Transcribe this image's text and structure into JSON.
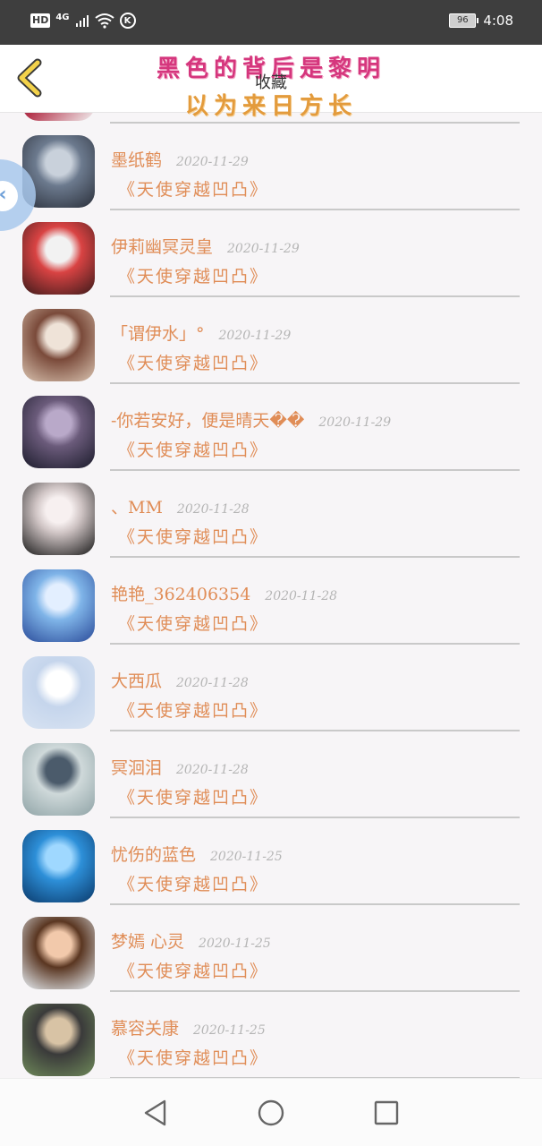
{
  "status_bar": {
    "hd": "HD",
    "network": "4G",
    "battery": "96",
    "time": "4:08",
    "icons": [
      "hd-icon",
      "signal-icon",
      "wifi-icon",
      "k-icon",
      "battery-icon"
    ]
  },
  "header": {
    "overlay_line1": "黑色的背后是黎明",
    "overlay_line2": "以为来日方长",
    "title": "收藏"
  },
  "entries": [
    {
      "name": "墨纸鹤",
      "date": "2020-11-29",
      "book": "《天使穿越凹凸》",
      "avatar_colors": [
        "#2a2f3a",
        "#6c7a8e",
        "#c9d1db"
      ]
    },
    {
      "name": "伊莉幽冥灵皇",
      "date": "2020-11-29",
      "book": "《天使穿越凹凸》",
      "avatar_colors": [
        "#3b1a1a",
        "#d94343",
        "#f2f2f2"
      ]
    },
    {
      "name": "「谓伊水」°",
      "date": "2020-11-29",
      "book": "《天使穿越凹凸》",
      "avatar_colors": [
        "#d9c3b0",
        "#7a4a3a",
        "#efe3d8"
      ]
    },
    {
      "name": "-你若安好，便是晴天��",
      "date": "2020-11-29",
      "book": "《天使穿越凹凸》",
      "avatar_colors": [
        "#1b1b2b",
        "#6b5b7b",
        "#b9a9c9"
      ]
    },
    {
      "name": "、MM",
      "date": "2020-11-28",
      "book": "《天使穿越凹凸》",
      "avatar_colors": [
        "#1a1a1a",
        "#cfc4c4",
        "#f7f0f0"
      ]
    },
    {
      "name": "艳艳_362406354",
      "date": "2020-11-28",
      "book": "《天使穿越凹凸》",
      "avatar_colors": [
        "#2b4c9a",
        "#7fb4e8",
        "#e3efff"
      ]
    },
    {
      "name": "大西瓜",
      "date": "2020-11-28",
      "book": "《天使穿越凹凸》",
      "avatar_colors": [
        "#d8e3f2",
        "#c5d5ec",
        "#ffffff"
      ]
    },
    {
      "name": "冥洄泪",
      "date": "2020-11-28",
      "book": "《天使穿越凹凸》",
      "avatar_colors": [
        "#8fa3a6",
        "#cfd9da",
        "#4b5b6b"
      ]
    },
    {
      "name": "忧伤的蓝色",
      "date": "2020-11-25",
      "book": "《天使穿越凹凸》",
      "avatar_colors": [
        "#0b3a6b",
        "#2d8fd8",
        "#9fd8ff"
      ]
    },
    {
      "name": "梦嫣 心灵",
      "date": "2020-11-25",
      "book": "《天使穿越凹凸》",
      "avatar_colors": [
        "#e9f1f7",
        "#5a3621",
        "#f2c9ab"
      ]
    },
    {
      "name": "慕容关康",
      "date": "2020-11-25",
      "book": "《天使穿越凹凸》",
      "avatar_colors": [
        "#6f8a5a",
        "#3a3a3a",
        "#d8c3a5"
      ]
    }
  ],
  "accent_colors": {
    "name": "#e08d57",
    "date": "#b5b5b5",
    "overlay_pink": "#d5367d",
    "overlay_orange": "#e39b3c",
    "back_arrow": "#e8c23a"
  }
}
